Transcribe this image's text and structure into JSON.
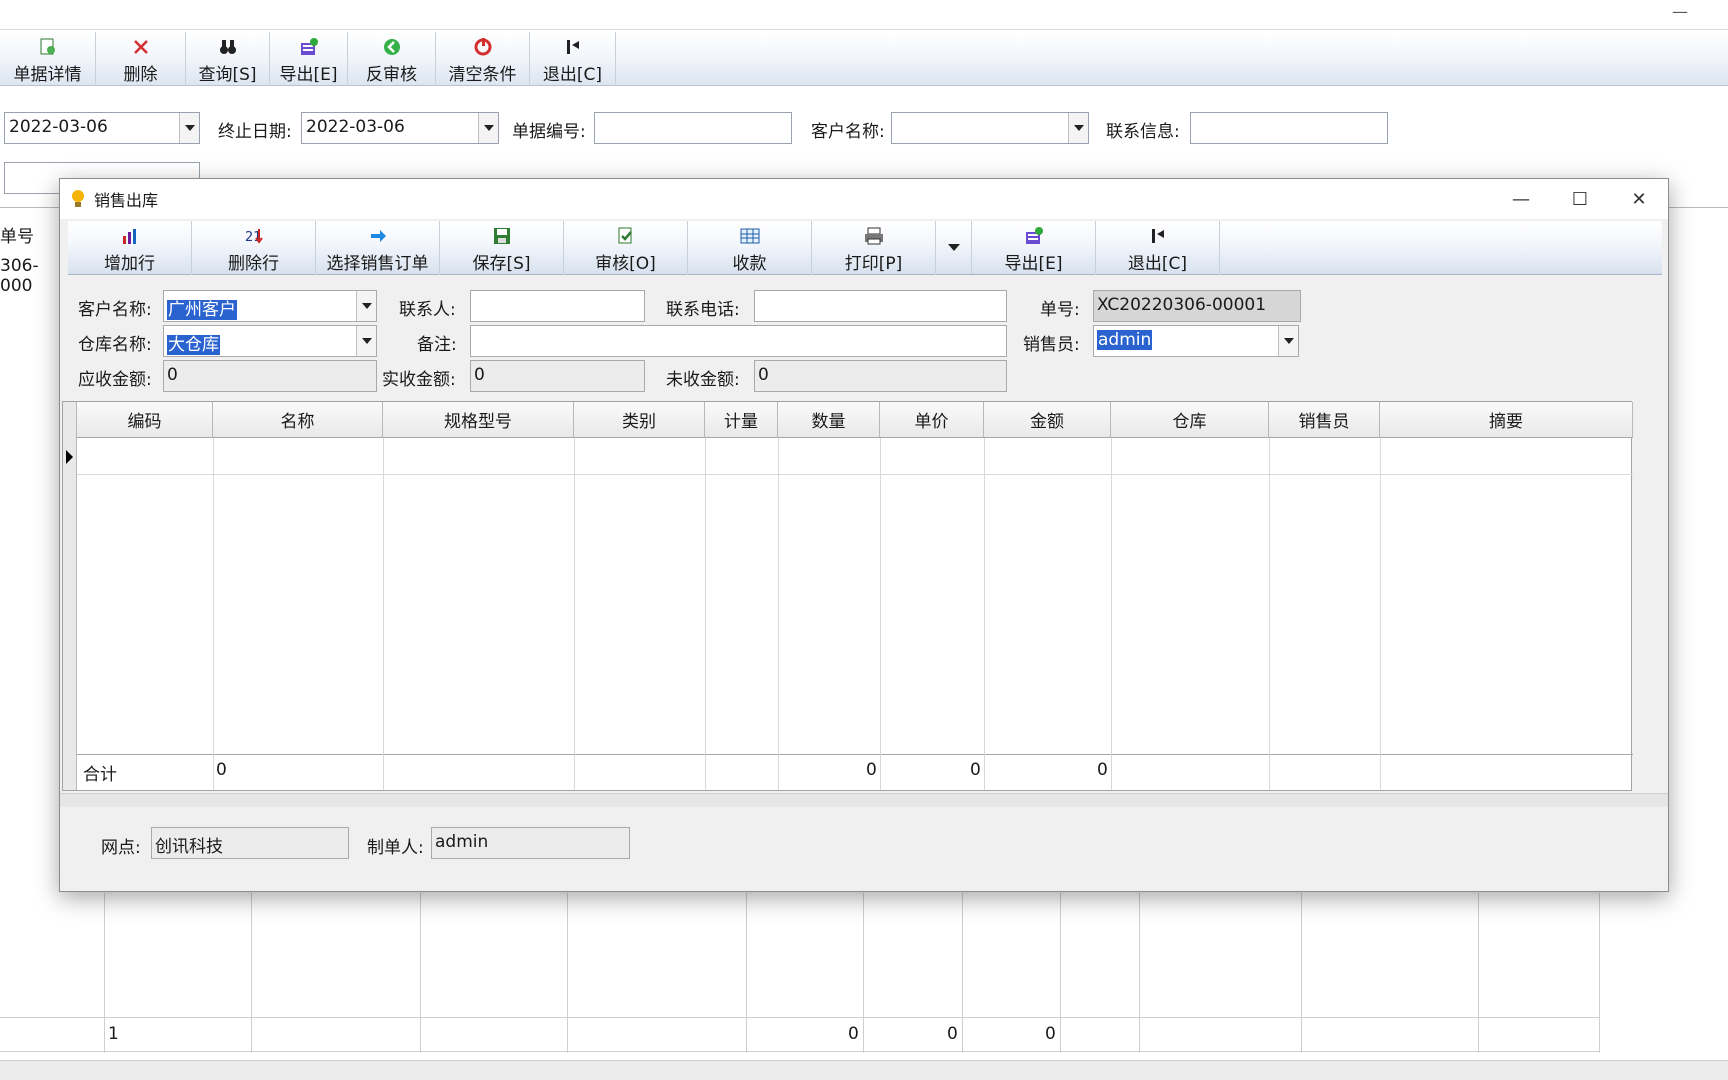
{
  "main_toolbar": [
    {
      "icon": "document-detail-icon",
      "label": "单据详情",
      "w": 96
    },
    {
      "icon": "delete-icon",
      "label": "删除",
      "w": 90
    },
    {
      "icon": "binoculars-icon",
      "label": "查询[S]",
      "w": 84
    },
    {
      "icon": "export-icon",
      "label": "导出[E]",
      "w": 78
    },
    {
      "icon": "unapprove-icon",
      "label": "反审核",
      "w": 88
    },
    {
      "icon": "clear-filter-icon",
      "label": "清空条件",
      "w": 94
    },
    {
      "icon": "exit-icon",
      "label": "退出[C]",
      "w": 86
    }
  ],
  "filters": {
    "start_date": "2022-03-06",
    "end_date_label": "终止日期:",
    "end_date": "2022-03-06",
    "doc_no_label": "单据编号:",
    "doc_no": "",
    "customer_label": "客户名称:",
    "customer": "",
    "contact_label": "联系信息:",
    "contact": ""
  },
  "main_list": {
    "col_doc_no": "单号",
    "row_doc_no": "306-000"
  },
  "main_grid_total": {
    "count": "1",
    "qty": "0",
    "price": "0",
    "amount": "0"
  },
  "dialog": {
    "title": "销售出库",
    "minimize": "—",
    "maximize": "☐",
    "close": "✕",
    "toolbar": [
      {
        "icon": "add-row-icon",
        "label": "增加行"
      },
      {
        "icon": "delete-row-icon",
        "label": "删除行"
      },
      {
        "icon": "select-order-icon",
        "label": "选择销售订单"
      },
      {
        "icon": "save-icon",
        "label": "保存[S]"
      },
      {
        "icon": "approve-icon",
        "label": "审核[O]"
      },
      {
        "icon": "receive-payment-icon",
        "label": "收款"
      },
      {
        "icon": "printer-icon",
        "label": "打印[P]"
      },
      {
        "icon": "export-icon",
        "label": "导出[E]"
      },
      {
        "icon": "exit-icon",
        "label": "退出[C]"
      }
    ],
    "form": {
      "customer_label": "客户名称:",
      "customer": "广州客户",
      "contact_person_label": "联系人:",
      "contact_person": "",
      "phone_label": "联系电话:",
      "phone": "",
      "order_no_label": "单号:",
      "order_no": "XC20220306-00001",
      "warehouse_label": "仓库名称:",
      "warehouse": "大仓库",
      "remark_label": "备注:",
      "remark": "",
      "salesperson_label": "销售员:",
      "salesperson": "admin",
      "receivable_label": "应收金额:",
      "receivable": "0",
      "received_label": "实收金额:",
      "received": "0",
      "unreceived_label": "未收金额:",
      "unreceived": "0"
    },
    "grid": {
      "columns": [
        "编码",
        "名称",
        "规格型号",
        "类别",
        "计量",
        "数量",
        "单价",
        "金额",
        "仓库",
        "销售员",
        "摘要"
      ],
      "total_label": "合计",
      "total_count": "0",
      "total_qty": "0",
      "total_price": "0",
      "total_amount": "0"
    },
    "footer": {
      "branch_label": "网点:",
      "branch": "创讯科技",
      "creator_label": "制单人:",
      "creator": "admin"
    }
  }
}
